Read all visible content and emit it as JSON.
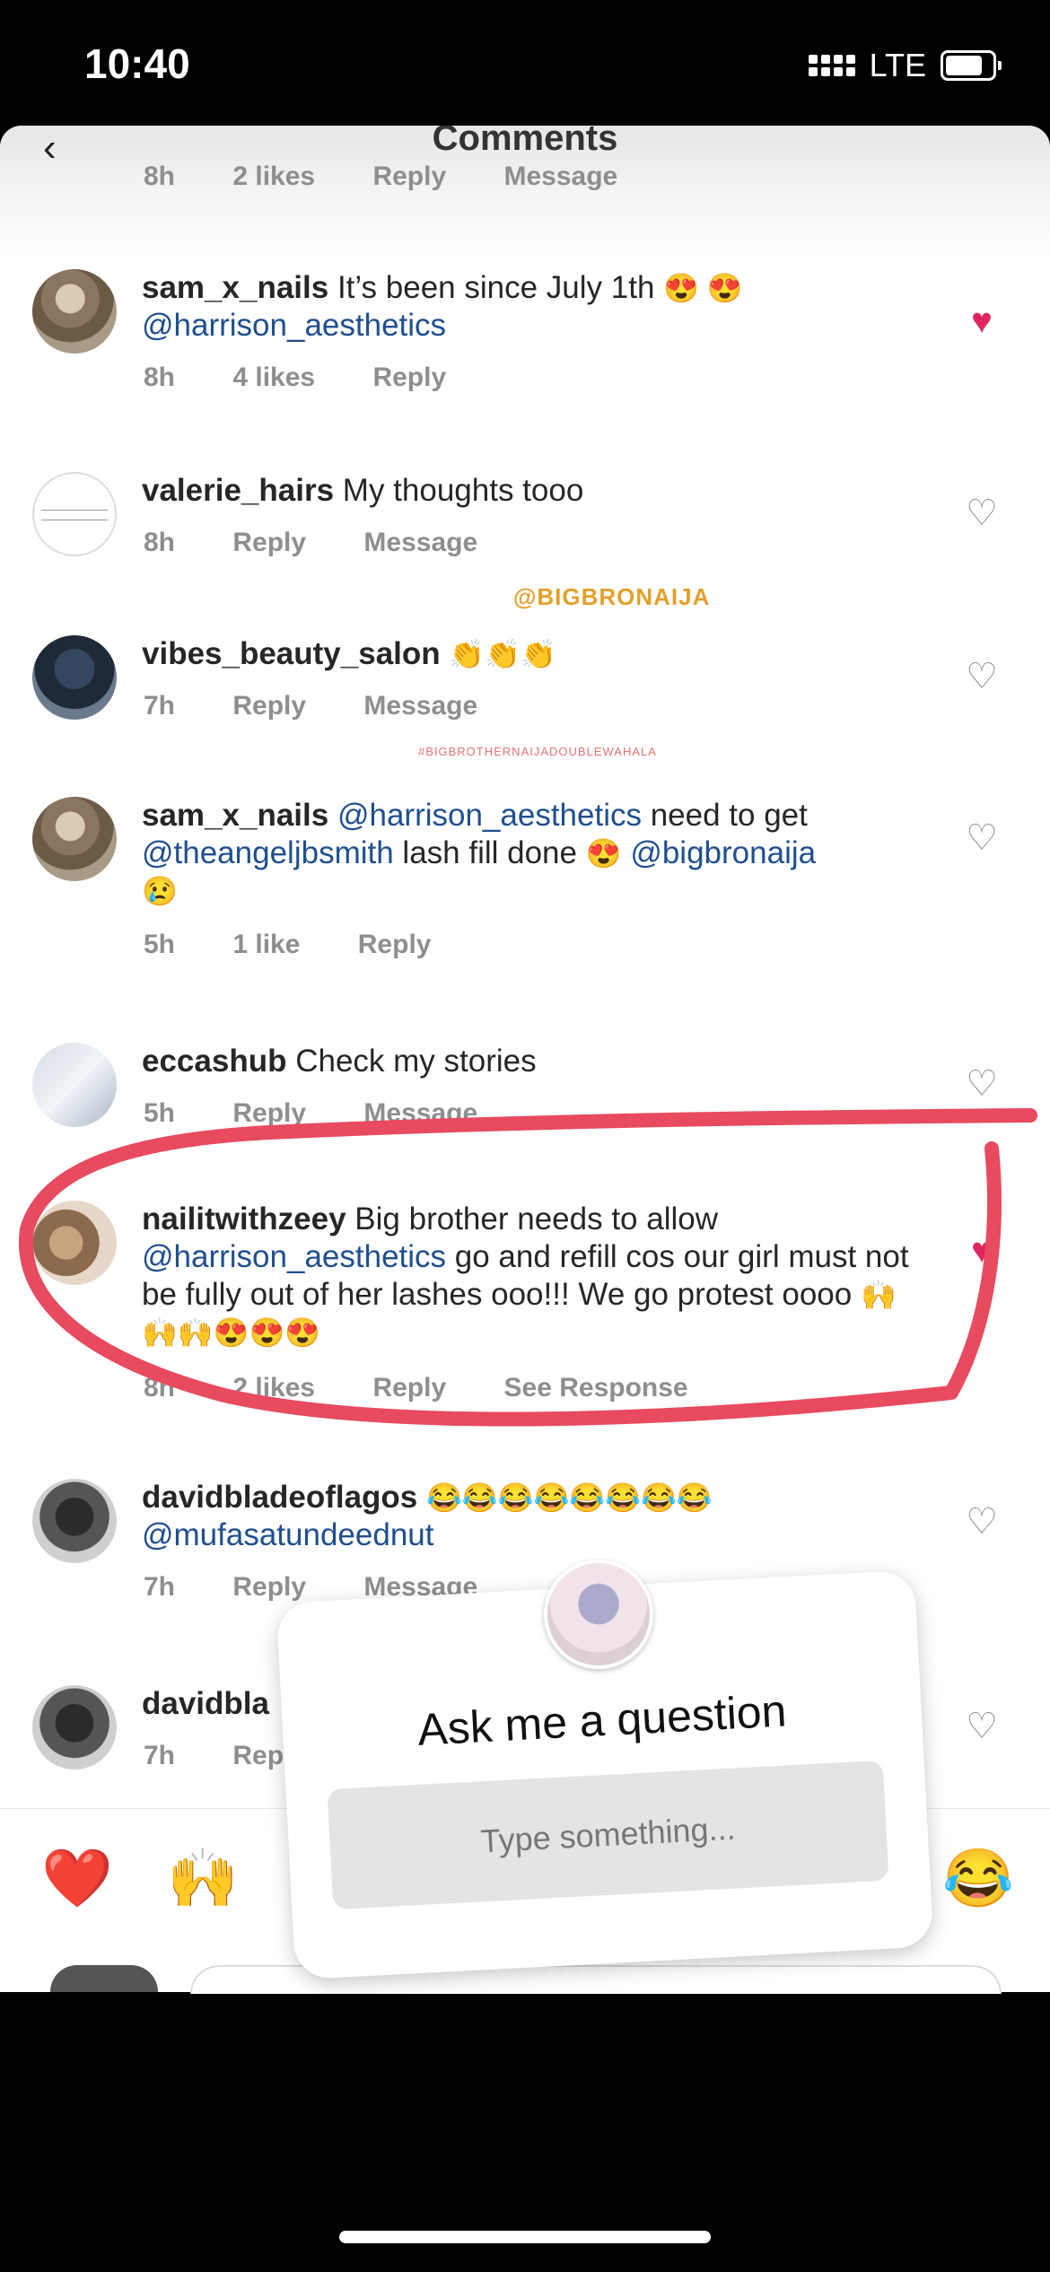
{
  "status": {
    "time": "10:40",
    "network": "LTE"
  },
  "header": {
    "title": "Comments"
  },
  "top_meta": {
    "time": "8h",
    "likes": "2 likes",
    "reply": "Reply",
    "message": "Message"
  },
  "comments": [
    {
      "user": "sam_x_nails",
      "text": "It’s been since July 1th",
      "emoji": "😍 😍",
      "mention": "@harrison_aesthetics",
      "time": "8h",
      "likes": "4 likes",
      "reply": "Reply",
      "liked": true
    },
    {
      "user": "valerie_hairs",
      "text": "My thoughts tooo",
      "time": "8h",
      "reply": "Reply",
      "message": "Message"
    },
    {
      "user": "vibes_beauty_salon",
      "emoji": "👏👏👏",
      "time": "7h",
      "reply": "Reply",
      "message": "Message"
    },
    {
      "user": "sam_x_nails",
      "mention1": "@harrison_aesthetics",
      "text1": "need to get",
      "mention2": "@theangeljbsmith",
      "text2": "lash fill done",
      "emoji1": "😍",
      "mention3": "@bigbronaija",
      "emoji2": "😢",
      "time": "5h",
      "likes": "1 like",
      "reply": "Reply"
    },
    {
      "user": "eccashub",
      "text": "Check my stories",
      "time": "5h",
      "reply": "Reply",
      "message": "Message"
    },
    {
      "user": "nailitwithzeey",
      "text1": "Big brother needs to allow",
      "mention": "@harrison_aesthetics",
      "text2": "go and refill cos our girl must not be fully out of her lashes ooo!!! We go protest oooo",
      "emoji": "🙌🙌🙌😍😍😍",
      "time": "8h",
      "likes": "2 likes",
      "reply": "Reply",
      "see_response": "See Response",
      "liked": true
    },
    {
      "user": "davidbladeoflagos",
      "emoji": "😂😂😂😂😂😂😂😂",
      "mention": "@mufasatundeednut",
      "time": "7h",
      "reply": "Reply",
      "message": "Message"
    },
    {
      "user": "davidbla",
      "time": "7h",
      "reply": "Reply"
    }
  ],
  "watermark": {
    "main": "@BIGBRONAIJA",
    "small": "#BIGBROTHERNAIJADOUBLEWAHALA"
  },
  "reactions": [
    "❤️",
    "🙌",
    "😂"
  ],
  "sticker": {
    "title": "Ask me a question",
    "placeholder": "Type something..."
  }
}
